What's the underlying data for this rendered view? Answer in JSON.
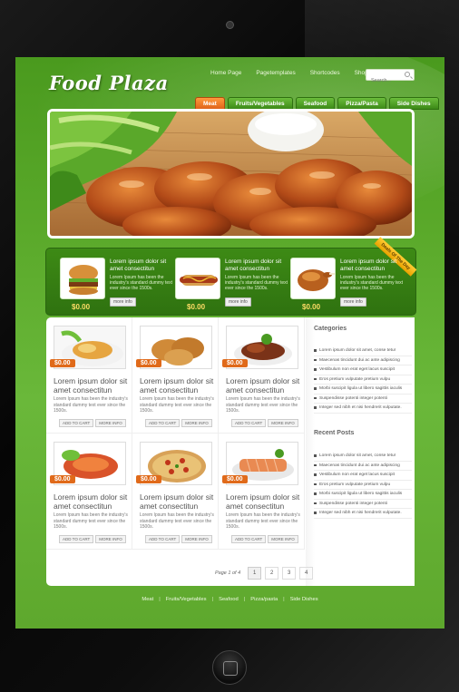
{
  "site": {
    "logo": "Food Plaza"
  },
  "topnav": [
    "Home Page",
    "Pagetemplates",
    "Shortcodes",
    "Shoppingcart"
  ],
  "search": {
    "placeholder": "Search..."
  },
  "category_tabs": [
    {
      "label": "Meat",
      "active": true
    },
    {
      "label": "Fruits/Vegetables",
      "active": false
    },
    {
      "label": "Seafood",
      "active": false
    },
    {
      "label": "Pizza/Pasta",
      "active": false
    },
    {
      "label": "Side Dishes",
      "active": false
    }
  ],
  "featured": {
    "ribbon": "Deals Of The Day",
    "items": [
      {
        "title": "Lorem ipsum dolor sit amet consectitun",
        "desc": "Lorem Ipsum has been the industry's standard dummy text ever since the 1500s.",
        "button": "more info",
        "price": "$0.00",
        "icon": "burger-icon"
      },
      {
        "title": "Lorem ipsum dolor sit amet consectitun",
        "desc": "Lorem Ipsum has been the industry's standard dummy text ever since the 1500s.",
        "button": "more info",
        "price": "$0.00",
        "icon": "hotdog-icon"
      },
      {
        "title": "Lorem ipsum dolor sit amet consectitun",
        "desc": "Lorem Ipsum has been the industry's standard dummy text ever since the 1500s.",
        "button": "more info",
        "price": "$0.00",
        "icon": "roast-chicken-icon"
      }
    ]
  },
  "products": [
    {
      "price": "$0.00",
      "title": "Lorem ipsum dolor sit amet consectitun",
      "desc": "Lorem Ipsum has been the industry's standard dummy text ever since the 1500s.",
      "add": "ADD TO CART",
      "more": "MORE INFO",
      "icon": "grilled-dish-icon"
    },
    {
      "price": "$0.00",
      "title": "Lorem ipsum dolor sit amet consectitun",
      "desc": "Lorem Ipsum has been the industry's standard dummy text ever since the 1500s.",
      "add": "ADD TO CART",
      "more": "MORE INFO",
      "icon": "fried-chicken-icon"
    },
    {
      "price": "$0.00",
      "title": "Lorem ipsum dolor sit amet consectitun",
      "desc": "Lorem Ipsum has been the industry's standard dummy text ever since the 1500s.",
      "add": "ADD TO CART",
      "more": "MORE INFO",
      "icon": "steak-icon"
    },
    {
      "price": "$0.00",
      "title": "Lorem ipsum dolor sit amet consectitun",
      "desc": "Lorem Ipsum has been the industry's standard dummy text ever since the 1500s.",
      "add": "ADD TO CART",
      "more": "MORE INFO",
      "icon": "lobster-icon"
    },
    {
      "price": "$0.00",
      "title": "Lorem ipsum dolor sit amet consectitun",
      "desc": "Lorem Ipsum has been the industry's standard dummy text ever since the 1500s.",
      "add": "ADD TO CART",
      "more": "MORE INFO",
      "icon": "pizza-icon"
    },
    {
      "price": "$0.00",
      "title": "Lorem ipsum dolor sit amet consectitun",
      "desc": "Lorem Ipsum has been the industry's standard dummy text ever since the 1500s.",
      "add": "ADD TO CART",
      "more": "MORE INFO",
      "icon": "salmon-icon"
    }
  ],
  "sidebar": {
    "categories_title": "Categories",
    "categories": [
      "Lorem ipsum dolor sit amet, conse tetur",
      "Maecenas tincidunt dui ac ante adipiscing",
      "Vestibulum non erat eget lacus suscipit",
      "Eros pretium vulputate pretium vulpu",
      "Morbi suscipit ligula ut libero sagittis iaculis",
      "Suspendisse potenti integer potenti",
      "Integer sed nibh et nisi hendrerit vulputate."
    ],
    "recent_title": "Recent Posts",
    "recent": [
      "Lorem ipsum dolor sit amet, conse tetur",
      "Maecenas tincidunt dui ac ante adipiscing",
      "Vestibulum non erat eget lacus suscipit",
      "Eros pretium vulputate pretium vulpu",
      "Morbi suscipit ligula ut libero sagittis iaculis",
      "Suspendisse potenti integer potenti",
      "Integer sed nibh et nisi hendrerit vulputate."
    ]
  },
  "pager": {
    "info": "Page 1 of 4",
    "pages": [
      "1",
      "2",
      "3",
      "4"
    ],
    "current": "1"
  },
  "footer": [
    "Meat",
    "Fruits/Vegetables",
    "Seafood",
    "Pizza/pasta",
    "Side Dishes"
  ]
}
